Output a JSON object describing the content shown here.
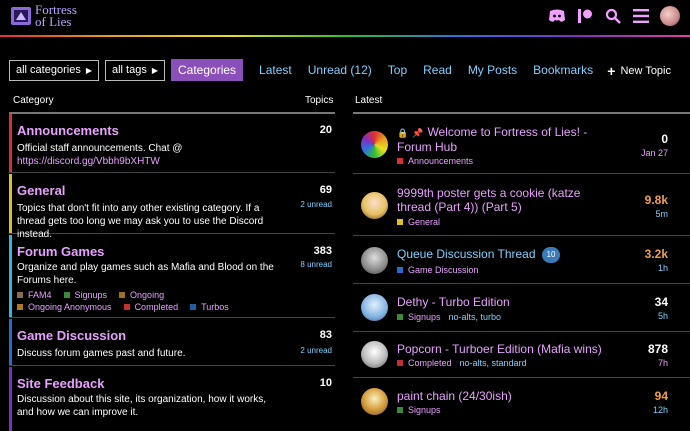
{
  "header": {
    "logo_text_1": "Fortress",
    "logo_text_2": "of Lies",
    "icons": [
      "discord-icon",
      "patreon-icon",
      "search-icon",
      "hamburger-menu-icon",
      "user-avatar"
    ]
  },
  "nav": {
    "categories_filter": "all categories",
    "tags_filter": "all tags",
    "links": [
      "Categories",
      "Latest",
      "Unread (12)",
      "Top",
      "Read",
      "My Posts",
      "Bookmarks"
    ],
    "new_topic": "New Topic"
  },
  "table": {
    "category_header": "Category",
    "topics_header": "Topics",
    "latest_header": "Latest"
  },
  "categories": [
    {
      "title": "Announcements",
      "desc": "Official staff announcements. Chat @ ",
      "link": "https://discord.gg/Vbbh9bXHTW",
      "count": "20",
      "unread": "",
      "color": "#d63030"
    },
    {
      "title": "General",
      "desc": "Topics that don't fit into any other existing category. If a thread gets too long we may ask you to use the Discord instead.",
      "count": "69",
      "unread": "2 unread",
      "color": "#e0c020"
    },
    {
      "title": "Forum Games",
      "desc": "Organize and play games such as Mafia and Blood on the Forums here.",
      "count": "383",
      "unread": "8 unread",
      "color": "#30b8e0",
      "subs": [
        {
          "name": "FAM4",
          "color": "#8a6a4a"
        },
        {
          "name": "Signups",
          "color": "#3a8a3a"
        },
        {
          "name": "Ongoing",
          "color": "#a07020"
        },
        {
          "name": "Ongoing Anonymous",
          "color": "#b07820"
        },
        {
          "name": "Completed",
          "color": "#c03030"
        },
        {
          "name": "Turbos",
          "color": "#2060a0"
        }
      ]
    },
    {
      "title": "Game Discussion",
      "desc": "Discuss forum games past and future.",
      "count": "83",
      "unread": "2 unread",
      "color": "#2a6ad0"
    },
    {
      "title": "Site Feedback",
      "desc": "Discussion about this site, its organization, how it works, and how we can improve it.",
      "count": "10",
      "unread": "",
      "color": "#7a30c0"
    }
  ],
  "topics": [
    {
      "title": "Welcome to Fortress of Lies! - Forum Hub",
      "category": "Announcements",
      "cat_color": "#d63030",
      "tags": "",
      "posts": "0",
      "age": "Jan 27",
      "posts_color": "#ffffff",
      "age_color": "#e8a0ff",
      "title_color": "pink",
      "pinned": true,
      "badge": ""
    },
    {
      "title": "9999th poster gets a cookie (katze thread (Part 4)) (Part 5)",
      "category": "General",
      "cat_color": "#e0c020",
      "tags": "",
      "posts": "9.8k",
      "age": "5m",
      "posts_color": "#f0a040",
      "age_color": "#7fd0ff",
      "title_color": "pink",
      "pinned": false,
      "badge": ""
    },
    {
      "title": "Queue Discussion Thread",
      "category": "Game Discussion",
      "cat_color": "#2a6ad0",
      "tags": "",
      "posts": "3.2k",
      "age": "1h",
      "posts_color": "#f0a040",
      "age_color": "#7fd0ff",
      "title_color": "blue",
      "pinned": false,
      "badge": "10"
    },
    {
      "title": "Dethy - Turbo Edition",
      "category": "Signups",
      "cat_color": "#3a8a3a",
      "tags": "no-alts, turbo",
      "posts": "34",
      "age": "5h",
      "posts_color": "#ffffff",
      "age_color": "#7fd0ff",
      "title_color": "pink",
      "pinned": false,
      "badge": ""
    },
    {
      "title": "Popcorn - Turboer Edition (Mafia wins)",
      "category": "Completed",
      "cat_color": "#c03030",
      "tags": "no-alts, standard",
      "posts": "878",
      "age": "7h",
      "posts_color": "#ffffff",
      "age_color": "#e8a0ff",
      "title_color": "pink",
      "pinned": false,
      "badge": ""
    },
    {
      "title": "paint chain (24/30ish)",
      "category": "Signups",
      "cat_color": "#3a8a3a",
      "tags": "",
      "posts": "94",
      "age": "12h",
      "posts_color": "#f0a040",
      "age_color": "#7fd0ff",
      "title_color": "pink",
      "pinned": false,
      "badge": ""
    }
  ]
}
